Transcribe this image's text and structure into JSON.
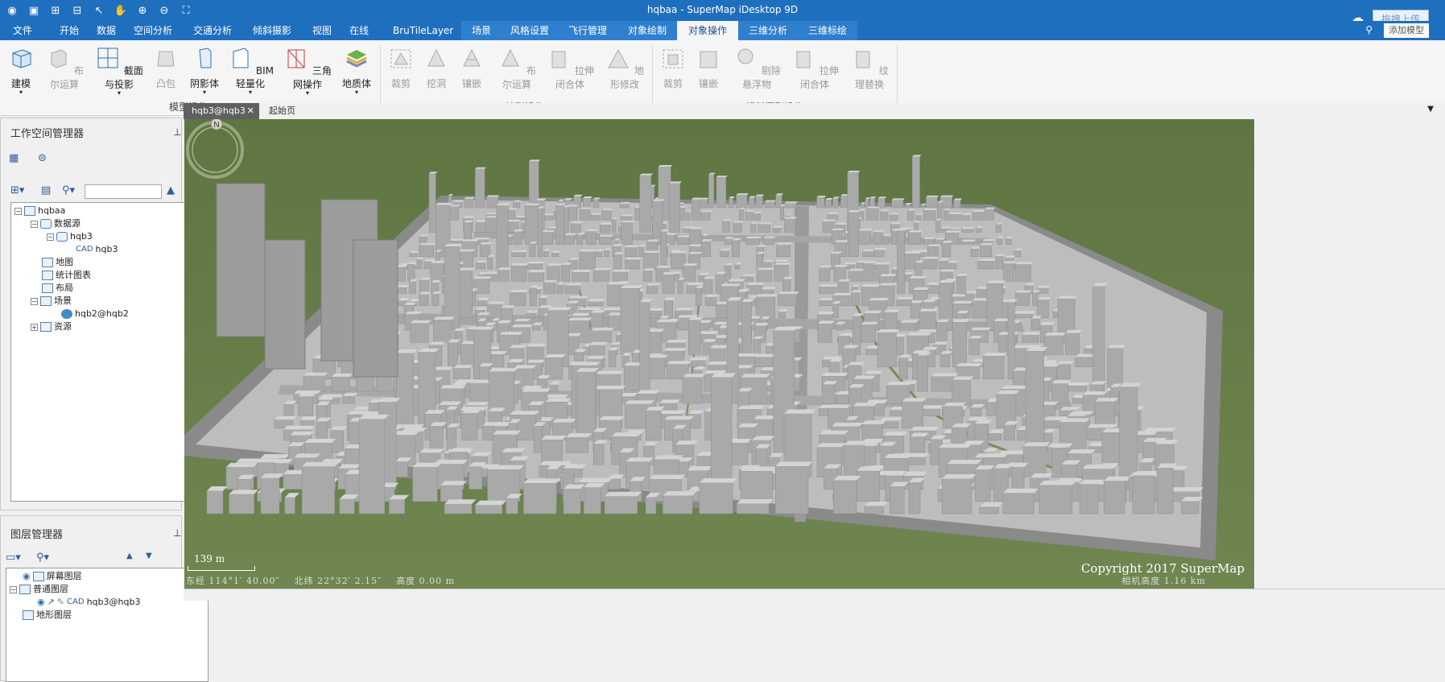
{
  "window": {
    "title": "hqbaa - SuperMap iDesktop 9D",
    "upload_button": "拖拽上传",
    "add_model": "添加模型"
  },
  "menu": [
    {
      "label": "文件",
      "state": "normal"
    },
    {
      "label": "开始",
      "state": "normal"
    },
    {
      "label": "数据",
      "state": "normal"
    },
    {
      "label": "空间分析",
      "state": "normal"
    },
    {
      "label": "交通分析",
      "state": "normal"
    },
    {
      "label": "倾斜摄影",
      "state": "normal"
    },
    {
      "label": "视图",
      "state": "normal"
    },
    {
      "label": "在线",
      "state": "normal"
    },
    {
      "label": "BruTileLayer",
      "state": "normal"
    },
    {
      "label": "场景",
      "state": "ctx"
    },
    {
      "label": "风格设置",
      "state": "ctx"
    },
    {
      "label": "飞行管理",
      "state": "ctx"
    },
    {
      "label": "对象绘制",
      "state": "ctx"
    },
    {
      "label": "对象操作",
      "state": "active"
    },
    {
      "label": "三维分析",
      "state": "ctx"
    },
    {
      "label": "三维标绘",
      "state": "ctx"
    }
  ],
  "ribbon": {
    "groups": [
      {
        "label": "模型操作"
      },
      {
        "label": "TIN地形操作"
      },
      {
        "label": "倾斜摄影操作"
      }
    ],
    "buttons": [
      {
        "label": "建模",
        "disabled": false,
        "dropdown": true
      },
      {
        "label": "布尔运算",
        "disabled": true,
        "dropdown": false
      },
      {
        "label": "截面与投影",
        "disabled": false,
        "dropdown": true
      },
      {
        "label": "凸包",
        "disabled": true,
        "dropdown": false
      },
      {
        "label": "阴影体",
        "disabled": false,
        "dropdown": true
      },
      {
        "label": "BIM轻量化",
        "disabled": false,
        "dropdown": true
      },
      {
        "label": "三角网操作",
        "disabled": false,
        "dropdown": true
      },
      {
        "label": "地质体",
        "disabled": false,
        "dropdown": true
      },
      {
        "label": "裁剪",
        "disabled": true,
        "dropdown": false
      },
      {
        "label": "挖洞",
        "disabled": true,
        "dropdown": false
      },
      {
        "label": "镶嵌",
        "disabled": true,
        "dropdown": false
      },
      {
        "label": "布尔运算",
        "disabled": true,
        "dropdown": false
      },
      {
        "label": "拉伸闭合体",
        "disabled": true,
        "dropdown": false
      },
      {
        "label": "地形修改",
        "disabled": true,
        "dropdown": false
      },
      {
        "label": "裁剪",
        "disabled": true,
        "dropdown": false
      },
      {
        "label": "镶嵌",
        "disabled": true,
        "dropdown": false
      },
      {
        "label": "剔除悬浮物",
        "disabled": true,
        "dropdown": false
      },
      {
        "label": "拉伸闭合体",
        "disabled": true,
        "dropdown": false
      },
      {
        "label": "纹理替换",
        "disabled": true,
        "dropdown": false
      }
    ]
  },
  "workspace": {
    "title": "工作空间管理器",
    "tree": [
      "hqbaa",
      "数据源",
      "hqb3",
      "hqb3",
      "地图",
      "统计图表",
      "布局",
      "场景",
      "hqb2@hqb2",
      "资源"
    ]
  },
  "layers": {
    "title": "图层管理器",
    "tree": [
      "屏幕图层",
      "普通图层",
      "hqb3@hqb3",
      "地形图层"
    ]
  },
  "tabs": [
    "hqb3@hqb3",
    "起始页"
  ],
  "scene": {
    "copyright": "Copyright 2017 SuperMap",
    "scale": "139 m",
    "longitude": "东经 114°1′ 40.00″",
    "latitude": "北纬 22°32′ 2.15″",
    "height": "高度 0.00 m",
    "camera_height": "相机高度 1.16 km",
    "compass_label": "N"
  }
}
